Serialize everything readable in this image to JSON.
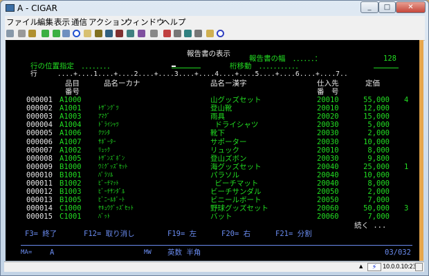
{
  "window": {
    "title": "A - CIGAR",
    "controls": [
      "_",
      "□",
      "✕"
    ]
  },
  "menu": [
    "ファイル",
    "編集",
    "表示",
    "通信",
    "アクション",
    "ウィンドウ",
    "ヘルプ"
  ],
  "screen": {
    "title": "報告書の表示",
    "width_label": "報告書の幅　．．．．．．：",
    "width_value": "128",
    "position_label": "行の位置指定　．．．．．．．．",
    "shift_label": "桁移動　．．．．．．．．．．．",
    "ruler": "行　　　....+....1....+....2....+....3....+....4....+....5....+....6....+....7..",
    "headers": {
      "item": "品目",
      "item2": "番号",
      "kana": "品名ーカナ",
      "kanji": "品名ー漢字",
      "supplier": "仕入先",
      "supplier2": "番　号",
      "price": "定価"
    },
    "rows": [
      {
        "seq": "000001",
        "code": "A1000",
        "kana": "",
        "kanji": "山グッズセット",
        "supplier": "20010",
        "price": "55,000",
        "extra": "4"
      },
      {
        "seq": "000002",
        "code": "A1001",
        "kana": "ﾄｻﾞﾝｸﾞﾂ",
        "kanji": "登山靴",
        "supplier": "20010",
        "price": "12,000",
        "extra": ""
      },
      {
        "seq": "000003",
        "code": "A1003",
        "kana": "ｱﾏｸﾞ",
        "kanji": "雨具",
        "supplier": "20020",
        "price": "15,000",
        "extra": ""
      },
      {
        "seq": "000004",
        "code": "A1004",
        "kana": "ﾄﾞﾗｲｼｬﾂ",
        "kanji": " ドライシャツ",
        "supplier": "20030",
        "price": "5,000",
        "extra": ""
      },
      {
        "seq": "000005",
        "code": "A1006",
        "kana": "ｸﾂｼﾀ",
        "kanji": "靴下",
        "supplier": "20030",
        "price": "2,000",
        "extra": ""
      },
      {
        "seq": "000006",
        "code": "A1007",
        "kana": "ｻﾎﾟｰﾀｰ",
        "kanji": "サポーター",
        "supplier": "20030",
        "price": "10,000",
        "extra": ""
      },
      {
        "seq": "000007",
        "code": "A1002",
        "kana": "ﾘｭｯｸ",
        "kanji": "リュック",
        "supplier": "20010",
        "price": "8,000",
        "extra": ""
      },
      {
        "seq": "000008",
        "code": "A1005",
        "kana": "ﾄｻﾞﾝｽﾞﾎﾞﾝ",
        "kanji": "登山ズボン",
        "supplier": "20030",
        "price": "9,800",
        "extra": ""
      },
      {
        "seq": "000009",
        "code": "B1000",
        "kana": "ｳﾐｸﾞｯｽﾞｾｯﾄ",
        "kanji": "海グッズセット",
        "supplier": "20040",
        "price": "25,000",
        "extra": "1"
      },
      {
        "seq": "000010",
        "code": "B1001",
        "kana": "ﾊﾟﾗｿﾙ",
        "kanji": "パラソル",
        "supplier": "20040",
        "price": "10,000",
        "extra": ""
      },
      {
        "seq": "000011",
        "code": "B1002",
        "kana": "ﾋﾞｰﾁﾏｯﾄ",
        "kanji": " ビーチマット",
        "supplier": "20040",
        "price": "8,000",
        "extra": ""
      },
      {
        "seq": "000012",
        "code": "B1003",
        "kana": "ﾋﾞｰﾁｻﾝﾀﾞﾙ",
        "kanji": "ビーチサンダル",
        "supplier": "20050",
        "price": "2,000",
        "extra": ""
      },
      {
        "seq": "000013",
        "code": "B1005",
        "kana": "ﾋﾞﾆｰﾙﾎﾞｰﾄ",
        "kanji": "ビニールボート",
        "supplier": "20050",
        "price": "7,000",
        "extra": ""
      },
      {
        "seq": "000014",
        "code": "C1000",
        "kana": "ﾔｷｭｳｸﾞｯｽﾞｾｯﾄ",
        "kanji": "野球グッズセット",
        "supplier": "20060",
        "price": "50,000",
        "extra": "3"
      },
      {
        "seq": "000015",
        "code": "C1001",
        "kana": "ﾊﾞｯﾄ",
        "kanji": "バット",
        "supplier": "20060",
        "price": "7,000",
        "extra": ""
      }
    ],
    "more": "続く ...",
    "fkeys": [
      "F3= 終了",
      "F12= 取り消し",
      "F19= 左",
      "F20= 右",
      "F21= 分割"
    ],
    "oia": {
      "ma": "MA=",
      "session": "A",
      "mw": "MW",
      "mode": "英数 半角",
      "cursor": "03/032"
    }
  },
  "statusbar": {
    "address": "10.0.0.10:23"
  }
}
